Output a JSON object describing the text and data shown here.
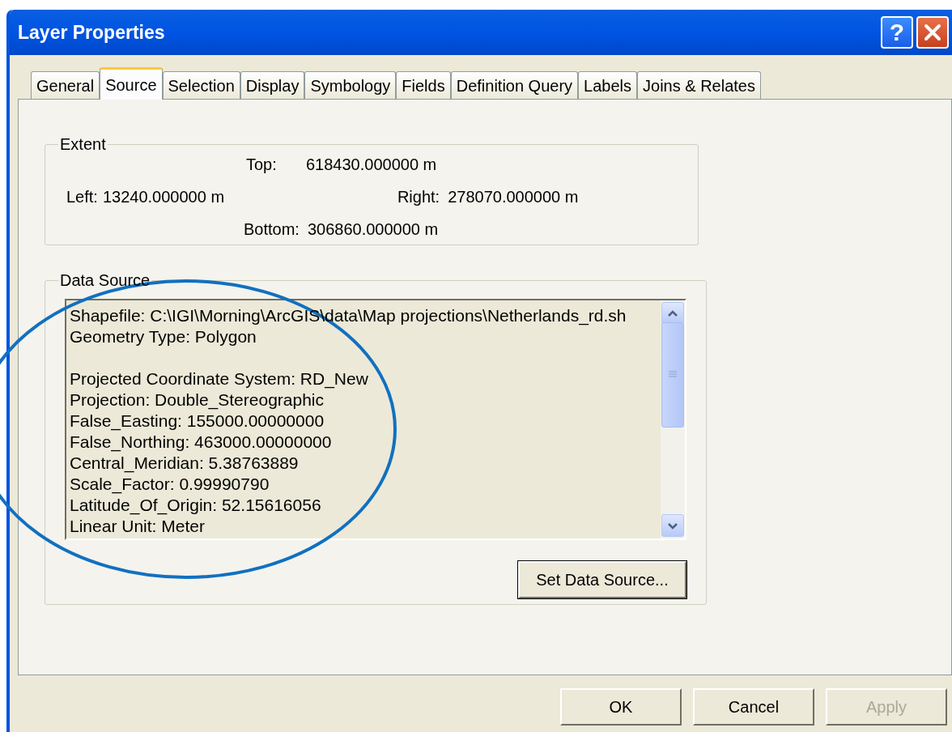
{
  "window": {
    "title": "Layer Properties"
  },
  "title_buttons": [
    {
      "kind": "help",
      "label": "?"
    },
    {
      "kind": "close"
    }
  ],
  "tabs": [
    {
      "label": "General",
      "selected": false
    },
    {
      "label": "Source",
      "selected": true
    },
    {
      "label": "Selection",
      "selected": false
    },
    {
      "label": "Display",
      "selected": false
    },
    {
      "label": "Symbology",
      "selected": false
    },
    {
      "label": "Fields",
      "selected": false
    },
    {
      "label": "Definition Query",
      "selected": false
    },
    {
      "label": "Labels",
      "selected": false
    },
    {
      "label": "Joins & Relates",
      "selected": false
    }
  ],
  "extent": {
    "title": "Extent",
    "top_label": "Top:",
    "top": "618430.000000 m",
    "left_label": "Left:",
    "left": "13240.000000 m",
    "right_label": "Right:",
    "right": "278070.000000 m",
    "bottom_label": "Bottom:",
    "bottom": "306860.000000 m"
  },
  "data_source": {
    "title": "Data Source",
    "lines": [
      {
        "kind": "text",
        "text": "Shapefile: C:\\IGI\\Morning\\ArcGIS\\data\\Map projections\\Netherlands_rd.sh"
      },
      {
        "kind": "text",
        "text": "Geometry Type: Polygon"
      },
      {
        "kind": "blank"
      },
      {
        "kind": "text",
        "text": "Projected Coordinate System: RD_New"
      },
      {
        "kind": "text",
        "text": "Projection: Double_Stereographic"
      },
      {
        "kind": "text",
        "text": "False_Easting: 155000.00000000"
      },
      {
        "kind": "text",
        "text": "False_Northing: 463000.00000000"
      },
      {
        "kind": "text",
        "text": "Central_Meridian: 5.38763889"
      },
      {
        "kind": "text",
        "text": "Scale_Factor: 0.99990790"
      },
      {
        "kind": "text",
        "text": "Latitude_Of_Origin: 52.15616056"
      },
      {
        "kind": "text",
        "text": "Linear Unit: Meter"
      }
    ],
    "button": "Set Data Source..."
  },
  "buttons": [
    {
      "label": "OK",
      "disabled": false
    },
    {
      "label": "Cancel",
      "disabled": false
    },
    {
      "label": "Apply",
      "disabled": true
    }
  ]
}
